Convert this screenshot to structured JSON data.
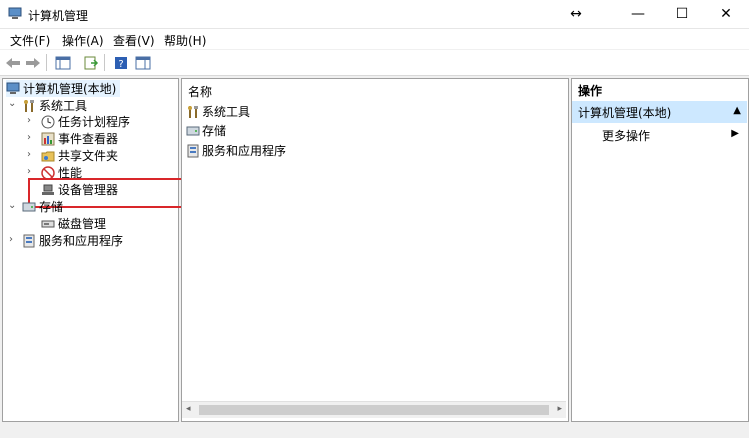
{
  "window": {
    "title": "计算机管理",
    "move_glyph": "↔",
    "minimize_glyph": "—",
    "maximize_glyph": "☐",
    "close_glyph": "✕"
  },
  "menu": [
    {
      "label": "文件(F)"
    },
    {
      "label": "操作(A)"
    },
    {
      "label": "查看(V)"
    },
    {
      "label": "帮助(H)"
    }
  ],
  "toolbar": {
    "icons": [
      "back-arrow-icon",
      "forward-arrow-icon",
      "show-hide-tree-icon",
      "export-list-icon",
      "help-icon",
      "show-action-pane-icon"
    ]
  },
  "tree": {
    "root": {
      "label": "计算机管理(本地)"
    },
    "system_tools": {
      "label": "系统工具",
      "children": [
        {
          "label": "任务计划程序"
        },
        {
          "label": "事件查看器"
        },
        {
          "label": "共享文件夹"
        },
        {
          "label": "性能"
        },
        {
          "label": "设备管理器"
        }
      ]
    },
    "storage": {
      "label": "存储",
      "children": [
        {
          "label": "磁盘管理"
        }
      ]
    },
    "services": {
      "label": "服务和应用程序"
    }
  },
  "list": {
    "header": "名称",
    "items": [
      {
        "label": "系统工具"
      },
      {
        "label": "存储"
      },
      {
        "label": "服务和应用程序"
      }
    ]
  },
  "actions": {
    "header": "操作",
    "section": "计算机管理(本地)",
    "items": [
      {
        "label": "更多操作"
      }
    ]
  },
  "colors": {
    "highlight_box": "#d9262a",
    "action_selected": "#cde8ff"
  }
}
